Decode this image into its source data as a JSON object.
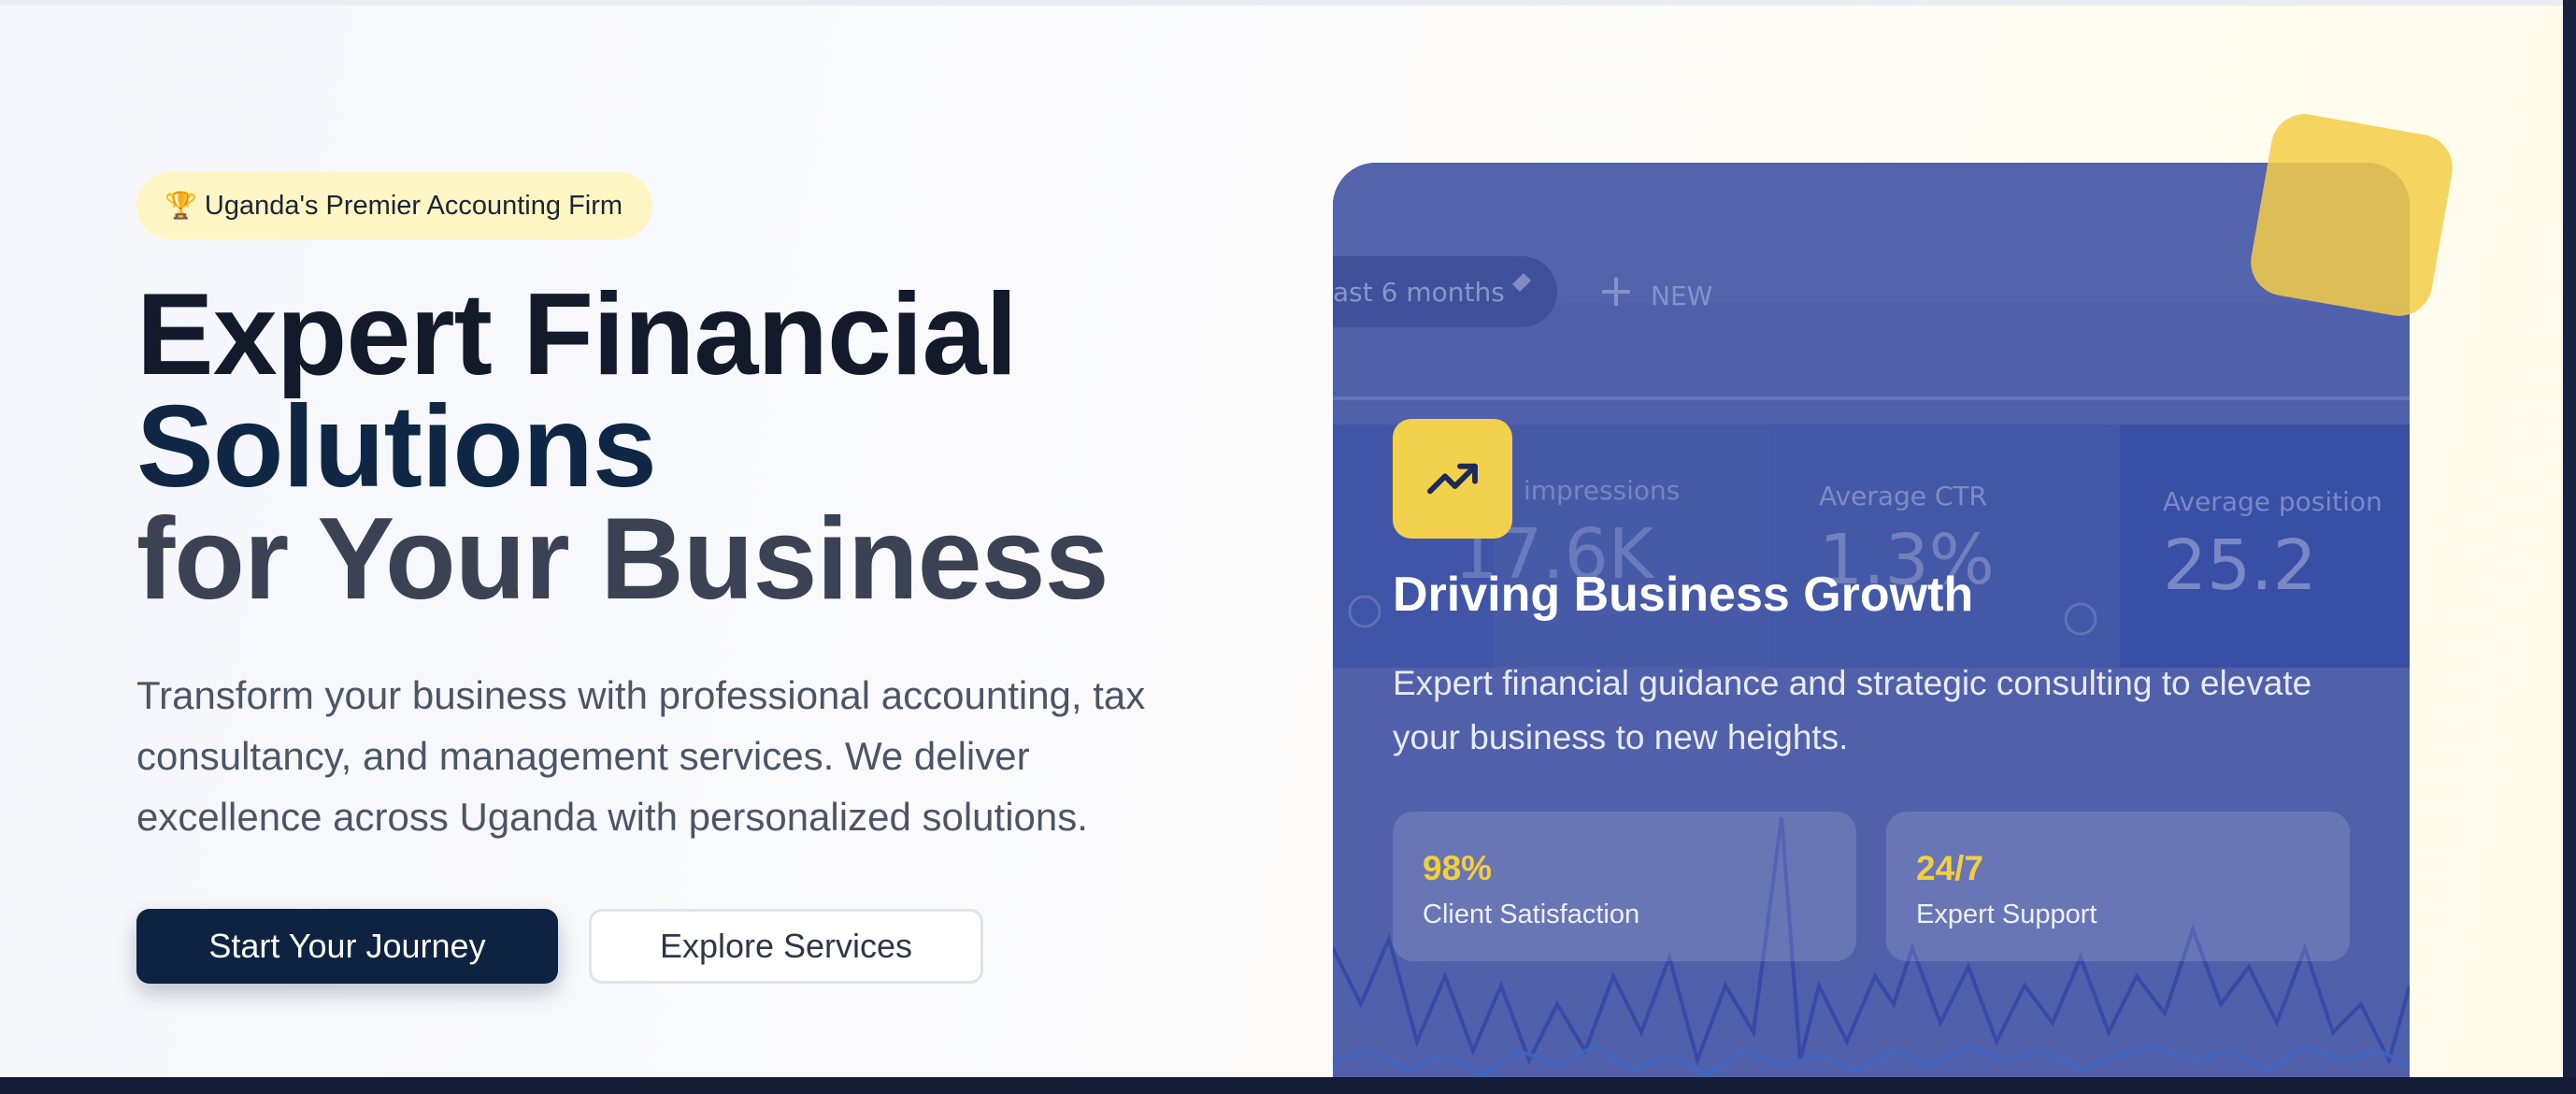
{
  "hero": {
    "badge": {
      "icon": "trophy-icon",
      "label": "Uganda's Premier Accounting Firm"
    },
    "headline": {
      "line1": "Expert Financial",
      "line2": "Solutions",
      "line3": "for Your Business"
    },
    "lead": "Transform your business with professional accounting, tax consultancy, and management services. We deliver excellence across Uganda with personalized solutions.",
    "primary_button": "Start Your Journey",
    "secondary_button": "Explore Services"
  },
  "card": {
    "icon": "trending-up-icon",
    "title": "Driving Business Growth",
    "description": "Expert financial guidance and strategic consulting to elevate your business to new heights.",
    "stats": [
      {
        "value": "98%",
        "label": "Client Satisfaction"
      },
      {
        "value": "24/7",
        "label": "Expert Support"
      }
    ],
    "background_screenshot": {
      "date_chip": "ast 6 months",
      "new_label": "NEW",
      "metrics": [
        {
          "label": "impressions",
          "value": "17.6K"
        },
        {
          "label": "Average CTR",
          "value": "1.3%"
        },
        {
          "label": "Average position",
          "value": "25.2"
        }
      ]
    }
  },
  "colors": {
    "primary_navy": "#0d2341",
    "accent_yellow": "#f2d14c",
    "badge_bg": "#fdf5c4",
    "card_blue": "#4a5aa8"
  }
}
